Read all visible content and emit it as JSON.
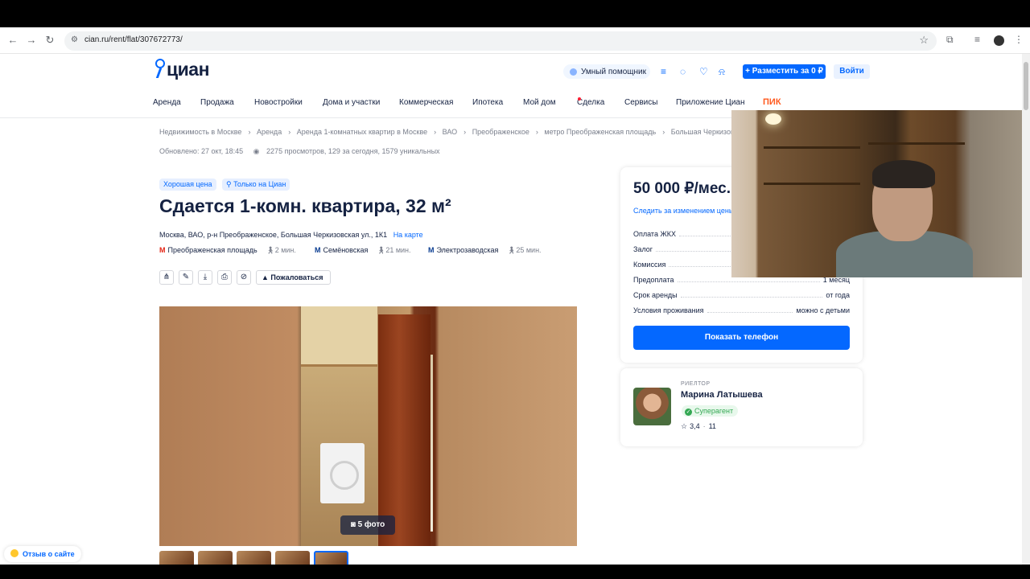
{
  "browser": {
    "url": "cian.ru/rent/flat/307672773/",
    "back_icon": "arrow-left-icon",
    "forward_icon": "arrow-right-icon",
    "reload_icon": "reload-icon"
  },
  "header": {
    "logo_text": "циан",
    "assistant_label": "Умный помощник",
    "post_button": "+ Разместить за 0 ₽",
    "login_button": "Войти"
  },
  "nav": {
    "items": [
      "Аренда",
      "Продажа",
      "Новостройки",
      "Дома и участки",
      "Коммерческая",
      "Ипотека",
      "Мой дом",
      "Сделка",
      "Сервисы",
      "Приложение Циан",
      "ПИК"
    ]
  },
  "breadcrumbs": [
    "Недвижимость в Москве",
    "Аренда",
    "Аренда 1-комнатных квартир в Москве",
    "ВАО",
    "Преображенское",
    "метро Преображенская площадь",
    "Большая Черкизовская ул"
  ],
  "meta": {
    "updated": "Обновлено: 27 окт, 18:45",
    "views": "2275 просмотров, 129 за сегодня, 1579 уникальных"
  },
  "badges": {
    "good_price": "Хорошая цена",
    "only_cian": "Только на Циан"
  },
  "listing": {
    "title": "Сдается 1-комн. квартира, 32 м²",
    "address": "Москва, ВАО, р-н Преображенское, Большая Черкизовская ул., 1К1",
    "map_link": "На карте",
    "metros": [
      {
        "name": "Преображенская площадь",
        "walk": "2 мин."
      },
      {
        "name": "Семёновская",
        "walk": "21 мин."
      },
      {
        "name": "Электрозаводская",
        "walk": "25 мин."
      }
    ],
    "report_button": "Пожаловаться",
    "photo_count": "5 фото"
  },
  "price_card": {
    "price": "50 000 ₽/мес.",
    "follow_link": "Следить за изменением цены",
    "terms": [
      {
        "label": "Оплата ЖКХ",
        "value": ""
      },
      {
        "label": "Залог",
        "value": ""
      },
      {
        "label": "Комиссия",
        "value": ""
      },
      {
        "label": "Предоплата",
        "value": "1 месяц"
      },
      {
        "label": "Срок аренды",
        "value": "от года"
      },
      {
        "label": "Условия проживания",
        "value": "можно с детьми"
      }
    ],
    "phone_button": "Показать телефон"
  },
  "agent": {
    "role": "РИЕЛТОР",
    "name": "Марина Латышева",
    "badge": "Суперагент",
    "rating": "3,4",
    "reviews": "11"
  },
  "feedback": "Отзыв о сайте",
  "colors": {
    "accent": "#0468ff",
    "text": "#152242",
    "muted": "#7a7f8c",
    "pik": "#ff5a1f"
  }
}
